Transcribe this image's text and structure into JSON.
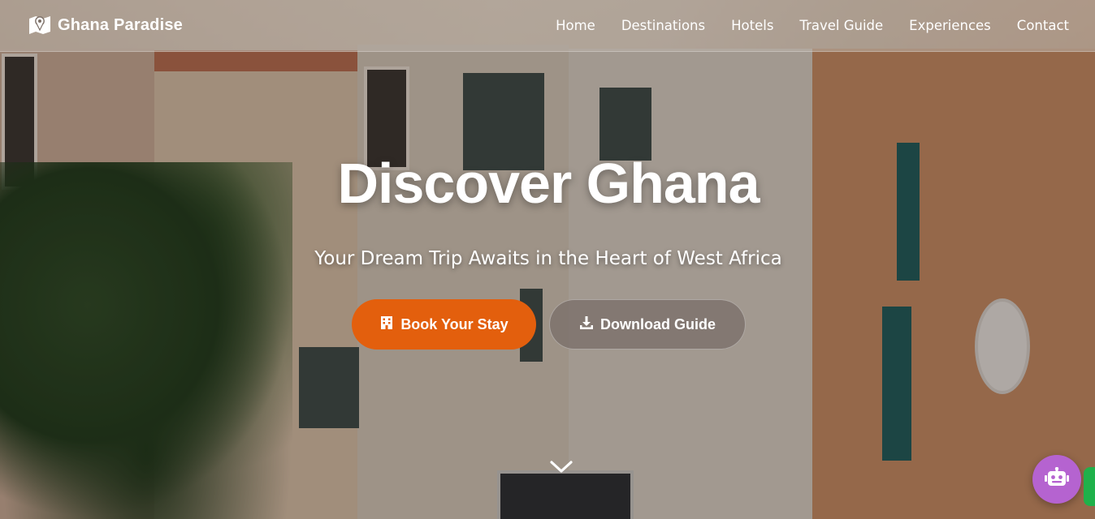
{
  "brand": {
    "name": "Ghana Paradise",
    "icon": "map-icon"
  },
  "nav": {
    "links": [
      "Home",
      "Destinations",
      "Hotels",
      "Travel Guide",
      "Experiences",
      "Contact"
    ]
  },
  "hero": {
    "title": "Discover Ghana",
    "subtitle": "Your Dream Trip Awaits in the Heart of West Africa",
    "primary_button": {
      "label": "Book Your Stay",
      "icon": "hotel-icon"
    },
    "secondary_button": {
      "label": "Download Guide",
      "icon": "download-icon"
    },
    "scroll_icon": "chevron-down-icon"
  },
  "widgets": {
    "chatbot_icon": "robot-icon",
    "side_tab_icon": "whatsapp-tab"
  },
  "colors": {
    "accent": "#e35f0d",
    "chatbot": "#b563d0",
    "side_tab": "#1fb14a"
  }
}
